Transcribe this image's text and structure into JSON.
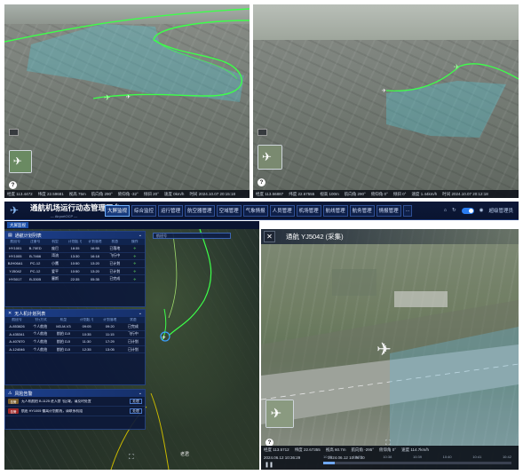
{
  "top_left": {
    "status": [
      "经度 113.4472",
      "纬度 22.59681",
      "视高 75m",
      "航向角 290°",
      "俯仰角 -32°",
      "倾斜 20°",
      "速度 0km/h",
      "时间 2024.10.07 20:15:18"
    ]
  },
  "top_right": {
    "status": [
      "经度 113.56887",
      "纬度 22.67555",
      "视高 100m",
      "航向角 290°",
      "俯仰角 0°",
      "倾斜 0°",
      "速度 1.44km/h",
      "时间 2024.10.07 20:12:18"
    ]
  },
  "header": {
    "title": "通航机场运行动态管理平台",
    "subtitle": "— AirportOCP —",
    "nav": [
      "大屏监视",
      "综合监控",
      "运行管理",
      "航空器管理",
      "空域管理",
      "气象情报",
      "人员管理",
      "机场管理",
      "航线管理",
      "航务管理",
      "情报管理",
      "..."
    ],
    "active_nav": "大屏监视",
    "user": "超级管理员"
  },
  "subtab": "大屏监视",
  "search_placeholder": "航班号",
  "flight_panel": {
    "title": "通航计划列表",
    "columns": [
      "航班号",
      "注册号",
      "机型",
      "计划起飞",
      "计划落地",
      "状态",
      "操作"
    ],
    "rows": [
      [
        "HY1001",
        "B-70ED",
        "庞巴",
        "18:35",
        "16:55",
        "已落地",
        "✈"
      ],
      [
        "HY1005",
        "B-7466",
        "湾流",
        "13:30",
        "16:18",
        "飞行中",
        "✈"
      ],
      [
        "BJH06A1",
        "PC-12",
        "小鹰",
        "10:50",
        "13:20",
        "已计划",
        "✈"
      ],
      [
        "YJ5042",
        "PC-12",
        "爱平",
        "10:50",
        "13:20",
        "已计划",
        "✈"
      ],
      [
        "HY5017",
        "B-3305",
        "塞斯",
        "22:35",
        "05:35",
        "已完成",
        "✈"
      ]
    ]
  },
  "uav_panel": {
    "title": "无人机计划列表",
    "columns": [
      "航班号",
      "飞行方式",
      "机型",
      "计划起飞",
      "计划落地",
      "状态"
    ],
    "rows": [
      [
        "A-853826",
        "个人航拍",
        "M3-M-V3",
        "09:05",
        "09:20",
        "已完成"
      ],
      [
        "A-435341",
        "个人航拍",
        "航拍 DJI",
        "10:35",
        "11:15",
        "飞行中"
      ],
      [
        "A-407870",
        "个人航拍",
        "航拍 DJI",
        "11:30",
        "17:29",
        "已计划"
      ],
      [
        "A-124046",
        "个人航拍",
        "航拍 DJI",
        "12:35",
        "13:05",
        "已计划"
      ]
    ]
  },
  "risk_panel": {
    "title": "风险告警",
    "items": [
      {
        "level": "告警",
        "text": "无人机航拍 B-1125 进入禁飞区域，请及时处置",
        "action": "处理"
      },
      {
        "level": "告警",
        "text": "航班 HY1005 偏离计划航线，请联系机组",
        "action": "处理"
      }
    ]
  },
  "video_panel": {
    "title": "通航 YJ5042 (采集)",
    "status": [
      "经度 113.5712",
      "纬度 22.67355",
      "视高 60.7m",
      "航向角 -295°",
      "俯仰角 0°",
      "速度 114.7km/h"
    ],
    "time_start": "2024.06.12 10:36:29",
    "time_now": "2024.06.12 10:36:30",
    "ticks": [
      "10:36",
      "10:37",
      "10:38",
      "10:39",
      "10:40",
      "10:41",
      "10:42"
    ]
  },
  "colors": {
    "route": "#3dff4a",
    "airspace": "#56c9d6",
    "header_bg": "#0c1838",
    "accent": "#2a7cf0"
  }
}
